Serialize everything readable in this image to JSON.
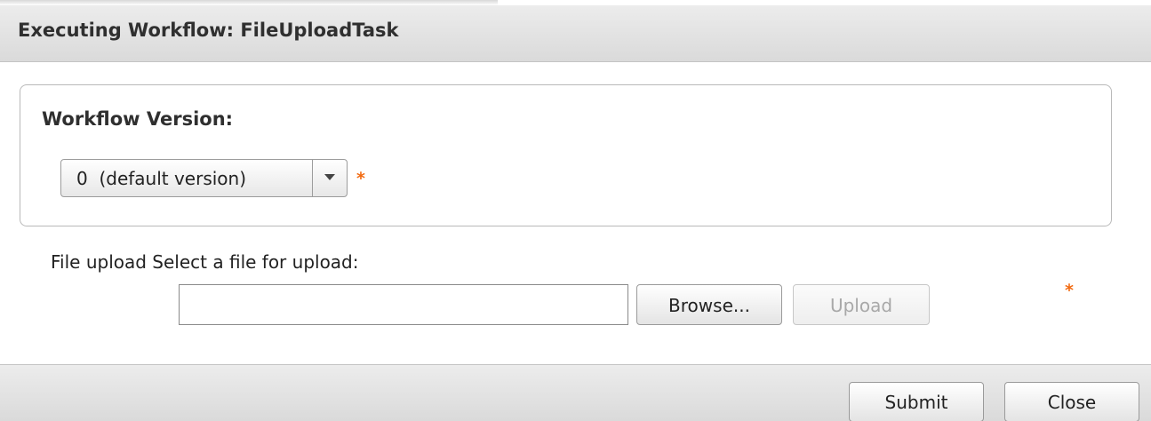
{
  "dialog": {
    "title": "Executing Workflow: FileUploadTask"
  },
  "workflow_version": {
    "label": "Workflow Version:",
    "selected": "0  (default version)",
    "required_marker": "*"
  },
  "file_upload": {
    "label": "File upload Select a file for upload:",
    "file_value": "",
    "browse_label": "Browse...",
    "upload_label": "Upload",
    "upload_enabled": false,
    "required_marker": "*"
  },
  "footer": {
    "submit_label": "Submit",
    "close_label": "Close"
  },
  "colors": {
    "required": "#f26a10",
    "header_bg": "#e2e2e2",
    "disabled_text": "#a8a8a8"
  }
}
